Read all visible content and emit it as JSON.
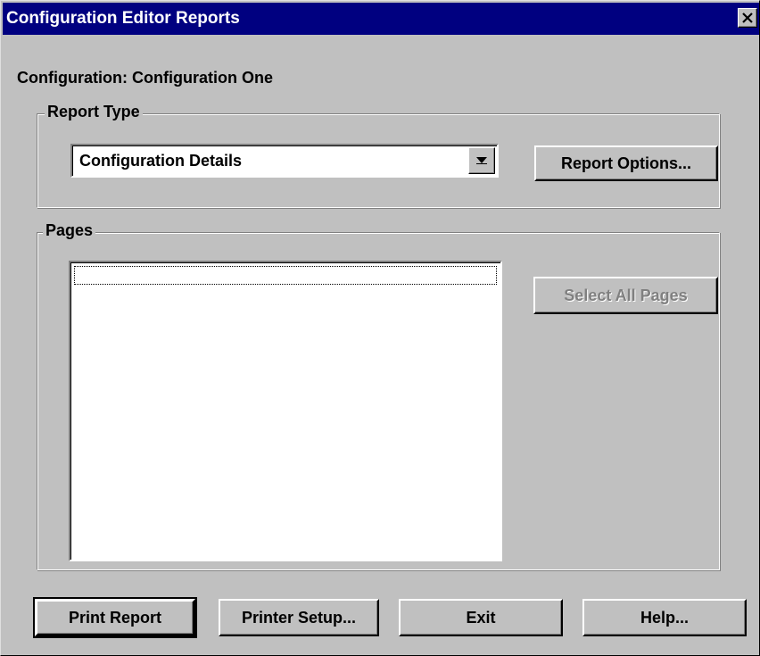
{
  "window": {
    "title": "Configuration Editor Reports",
    "close_label": "Close"
  },
  "config": {
    "label": "Configuration: Configuration One"
  },
  "report_type": {
    "legend": "Report Type",
    "selected_value": "Configuration Details",
    "options_button": "Report Options..."
  },
  "pages": {
    "legend": "Pages",
    "items": [],
    "select_all_button": "Select All Pages",
    "select_all_enabled": false
  },
  "footer": {
    "print_report": "Print Report",
    "printer_setup": "Printer Setup...",
    "exit": "Exit",
    "help": "Help..."
  },
  "icons": {
    "close": "close-icon",
    "dropdown": "chevron-down-icon"
  },
  "colors": {
    "titlebar": "#000080",
    "face": "#c0c0c0",
    "disabled_text": "#808080"
  }
}
